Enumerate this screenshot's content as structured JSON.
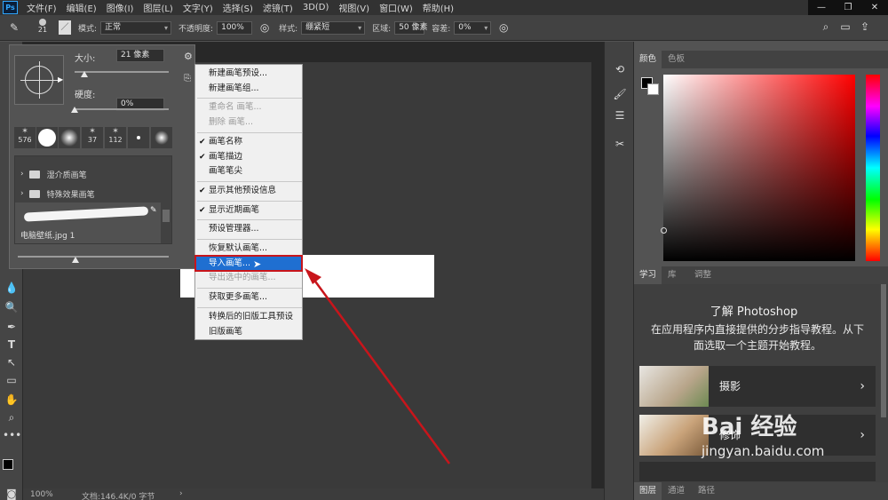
{
  "app": {
    "logo": "Ps"
  },
  "menubar": [
    "文件(F)",
    "编辑(E)",
    "图像(I)",
    "图层(L)",
    "文字(Y)",
    "选择(S)",
    "滤镜(T)",
    "3D(D)",
    "视图(V)",
    "窗口(W)",
    "帮助(H)"
  ],
  "window_controls": [
    "—",
    "❐",
    "✕"
  ],
  "options": {
    "brush_size": "21",
    "mode_label": "模式:",
    "mode_value": "正常",
    "opacity_label": "不透明度:",
    "opacity_value": "100%",
    "style_label": "样式:",
    "style_value": "绷紧短",
    "area_label": "区域:",
    "area_value": "50 像素",
    "tolerance_label": "容差:",
    "tolerance_value": "0%"
  },
  "brush_panel": {
    "size_label": "大小:",
    "size_value": "21 像素",
    "hardness_label": "硬度:",
    "hardness_value": "0%",
    "size_fraction": 0.1,
    "hardness_fraction": 0.0,
    "presets": [
      "576",
      "",
      "",
      "37",
      "112",
      "",
      ""
    ],
    "folders": [
      "湿介质画笔",
      "特殊效果画笔"
    ],
    "selected_brush": "电脑壁纸.jpg 1"
  },
  "context_menu": [
    {
      "label": "新建画笔预设...",
      "checked": false,
      "disabled": false
    },
    {
      "label": "新建画笔组...",
      "checked": false,
      "disabled": false
    },
    {
      "sep": true
    },
    {
      "label": "重命名 画笔...",
      "checked": false,
      "disabled": true
    },
    {
      "label": "删除 画笔...",
      "checked": false,
      "disabled": true
    },
    {
      "sep": true
    },
    {
      "label": "画笔名称",
      "checked": true,
      "disabled": false
    },
    {
      "label": "画笔描边",
      "checked": true,
      "disabled": false
    },
    {
      "label": "画笔笔尖",
      "checked": false,
      "disabled": false
    },
    {
      "sep": true
    },
    {
      "label": "显示其他预设信息",
      "checked": true,
      "disabled": false
    },
    {
      "sep": true
    },
    {
      "label": "显示近期画笔",
      "checked": true,
      "disabled": false
    },
    {
      "sep": true
    },
    {
      "label": "预设管理器...",
      "checked": false,
      "disabled": false
    },
    {
      "sep": true
    },
    {
      "label": "恢复默认画笔...",
      "checked": false,
      "disabled": false
    },
    {
      "label": "导入画笔...",
      "checked": false,
      "disabled": false,
      "highlight": true
    },
    {
      "label": "导出选中的画笔...",
      "checked": false,
      "disabled": true
    },
    {
      "sep": true
    },
    {
      "label": "获取更多画笔...",
      "checked": false,
      "disabled": false
    },
    {
      "sep": true
    },
    {
      "label": "转换后的旧版工具预设",
      "checked": false,
      "disabled": false
    },
    {
      "label": "旧版画笔",
      "checked": false,
      "disabled": false
    }
  ],
  "status": {
    "zoom": "100%",
    "doc": "文档:146.4K/0 字节"
  },
  "right_panel": {
    "color_tabs": [
      "颜色",
      "色板"
    ],
    "learn_tabs": [
      "学习",
      "库",
      "调整"
    ],
    "learn_title": "了解 Photoshop",
    "learn_desc": "在应用程序内直接提供的分步指导教程。从下面选取一个主题开始教程。",
    "lessons": [
      "摄影",
      "修饰"
    ],
    "layer_tabs": [
      "图层",
      "通道",
      "路径"
    ]
  },
  "watermark": {
    "brand": "Bai  经验",
    "url": "jingyan.baidu.com"
  },
  "colors": {
    "highlight": "#1f6fd1",
    "annotation_red": "#c8151b",
    "ps_blue": "#31a8ff"
  }
}
